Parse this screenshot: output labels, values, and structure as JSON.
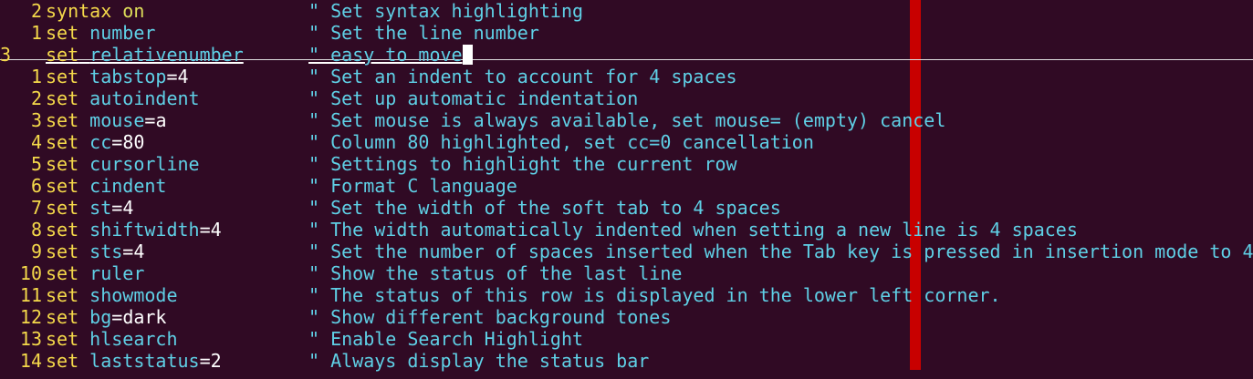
{
  "editor": {
    "colors": {
      "background": "#300a24",
      "line_number": "#f5d94a",
      "keyword": "#f5d94a",
      "option": "#5fd0e6",
      "comment": "#5fd0e6",
      "color_column": "#c80000"
    },
    "lines": [
      {
        "num": "2",
        "kw": "syntax",
        "opt": "",
        "eq": "",
        "val": "",
        "kwval": "on",
        "comment": "\" Set syntax highlighting"
      },
      {
        "num": "1",
        "kw": "set",
        "opt": "number",
        "eq": "",
        "val": "",
        "kwval": "",
        "comment": "\" Set the line number"
      },
      {
        "num": "3",
        "kw": "set",
        "opt": "relativenumber",
        "eq": "",
        "val": "",
        "kwval": "",
        "comment": "\" easy to move",
        "current": true
      },
      {
        "num": "1",
        "kw": "set",
        "opt": "tabstop",
        "eq": "=",
        "val": "4",
        "kwval": "",
        "comment": "\" Set an indent to account for 4 spaces"
      },
      {
        "num": "2",
        "kw": "set",
        "opt": "autoindent",
        "eq": "",
        "val": "",
        "kwval": "",
        "comment": "\" Set up automatic indentation"
      },
      {
        "num": "3",
        "kw": "set",
        "opt": "mouse",
        "eq": "=",
        "val": "a",
        "kwval": "",
        "comment": "\" Set mouse is always available, set mouse= (empty) cancel"
      },
      {
        "num": "4",
        "kw": "set",
        "opt": "cc",
        "eq": "=",
        "val": "80",
        "kwval": "",
        "comment": "\" Column 80 highlighted, set cc=0 cancellation"
      },
      {
        "num": "5",
        "kw": "set",
        "opt": "cursorline",
        "eq": "",
        "val": "",
        "kwval": "",
        "comment": "\" Settings to highlight the current row"
      },
      {
        "num": "6",
        "kw": "set",
        "opt": "cindent",
        "eq": "",
        "val": "",
        "kwval": "",
        "comment": "\" Format C language"
      },
      {
        "num": "7",
        "kw": "set",
        "opt": "st",
        "eq": "=",
        "val": "4",
        "kwval": "",
        "comment": "\" Set the width of the soft tab to 4 spaces"
      },
      {
        "num": "8",
        "kw": "set",
        "opt": "shiftwidth",
        "eq": "=",
        "val": "4",
        "kwval": "",
        "comment": "\" The width automatically indented when setting a new line is 4 spaces"
      },
      {
        "num": "9",
        "kw": "set",
        "opt": "sts",
        "eq": "=",
        "val": "4",
        "kwval": "",
        "comment": "\" Set the number of spaces inserted when the Tab key is pressed in insertion mode to 4"
      },
      {
        "num": "10",
        "kw": "set",
        "opt": "ruler",
        "eq": "",
        "val": "",
        "kwval": "",
        "comment": "\" Show the status of the last line"
      },
      {
        "num": "11",
        "kw": "set",
        "opt": "showmode",
        "eq": "",
        "val": "",
        "kwval": "",
        "comment": "\" The status of this row is displayed in the lower left corner."
      },
      {
        "num": "12",
        "kw": "set",
        "opt": "bg",
        "eq": "=",
        "val": "dark",
        "kwval": "",
        "comment": "\" Show different background tones"
      },
      {
        "num": "13",
        "kw": "set",
        "opt": "hlsearch",
        "eq": "",
        "val": "",
        "kwval": "",
        "comment": "\" Enable Search Highlight"
      },
      {
        "num": "14",
        "kw": "set",
        "opt": "laststatus",
        "eq": "=",
        "val": "2",
        "kwval": "",
        "comment": "\" Always display the status bar"
      }
    ]
  }
}
